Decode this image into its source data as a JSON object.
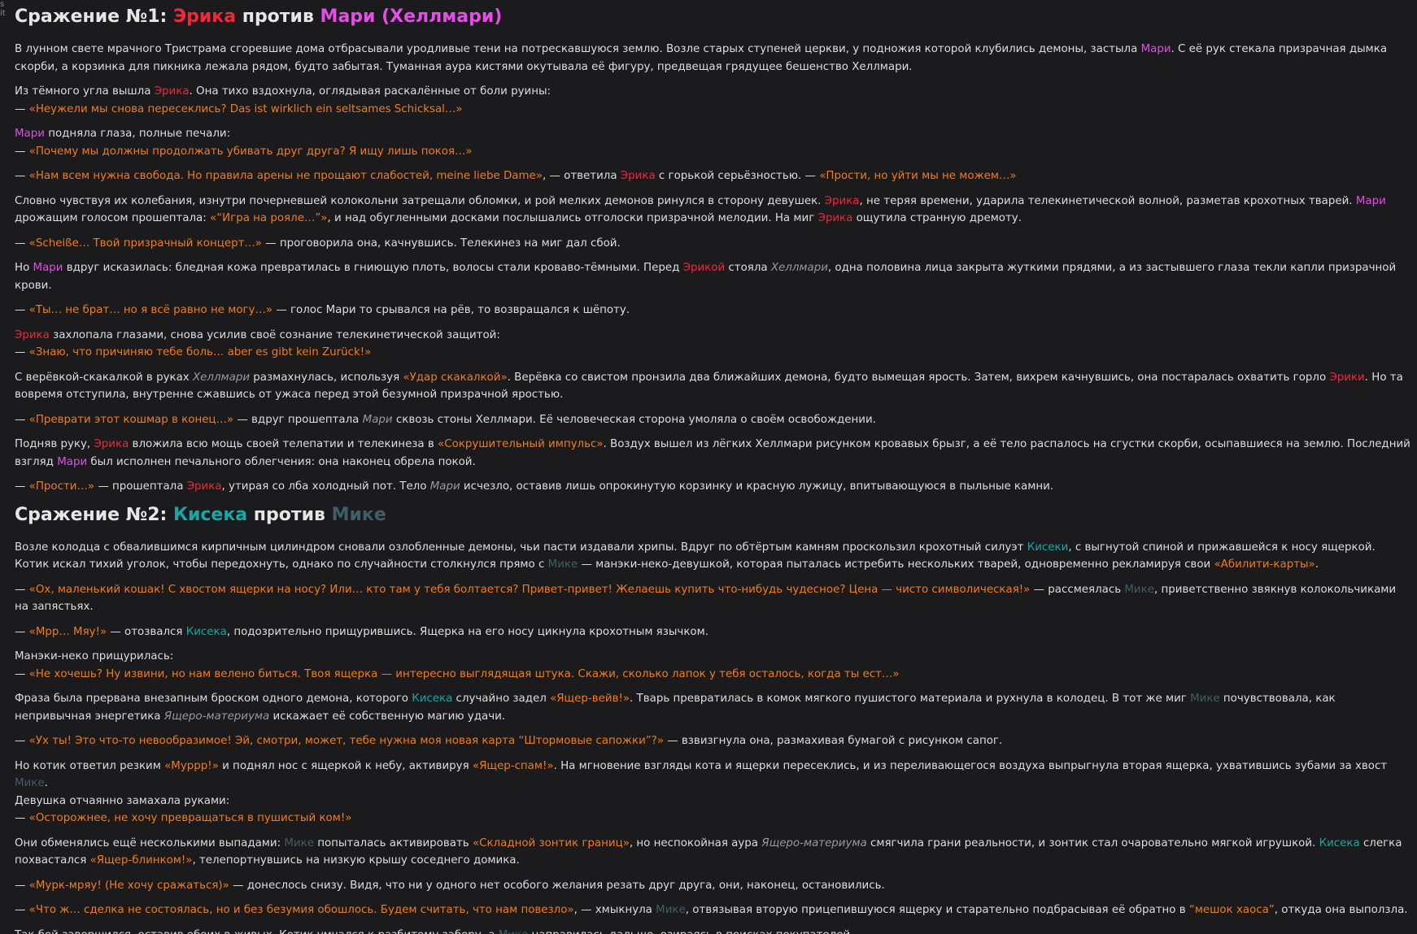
{
  "edge_marks": "s\nit",
  "colors": {
    "background": "#1b1b1d",
    "text": "#dedede",
    "erika": "#f0283c",
    "mari": "#e24ee6",
    "kiseka": "#1aa6a6",
    "mike": "#3f5f66",
    "quote": "#f17c1c",
    "italic": "#9a9a9a"
  },
  "sections": [
    {
      "heading": [
        {
          "t": "Сражение №1: ",
          "s": "plain"
        },
        {
          "t": "Эрика",
          "s": "erika"
        },
        {
          "t": " против ",
          "s": "plain"
        },
        {
          "t": "Мари (Хеллмари)",
          "s": "mari"
        }
      ],
      "paragraphs": [
        [
          {
            "t": "В лунном свете мрачного Тристрама сгоревшие дома отбрасывали уродливые тени на потрескавшуюся землю. Возле старых ступеней церкви, у подножия которой клубились демоны, застыла ",
            "s": "plain"
          },
          {
            "t": "Мари",
            "s": "mari"
          },
          {
            "t": ". С её рук стекала призрачная дымка скорби, а корзинка для пикника лежала рядом, будто забытая. Туманная аура кистями окутывала её фигуру, предвещая грядущее бешенство Хеллмари.",
            "s": "plain"
          }
        ],
        [
          {
            "t": "Из тёмного угла вышла ",
            "s": "plain"
          },
          {
            "t": "Эрика",
            "s": "erika"
          },
          {
            "t": ". Она тихо вздохнула, оглядывая раскалённые от боли руины:",
            "s": "plain"
          },
          {
            "t": "\n",
            "s": "br"
          },
          {
            "t": "— ",
            "s": "plain"
          },
          {
            "t": "«Неужели мы снова пересеклись? Das ist wirklich ein seltsames Schicksal…»",
            "s": "quote"
          }
        ],
        [
          {
            "t": "Мари",
            "s": "mari"
          },
          {
            "t": " подняла глаза, полные печали:",
            "s": "plain"
          },
          {
            "t": "\n",
            "s": "br"
          },
          {
            "t": "— ",
            "s": "plain"
          },
          {
            "t": "«Почему мы должны продолжать убивать друг друга? Я ищу лишь покоя…»",
            "s": "quote"
          }
        ],
        [
          {
            "t": "— ",
            "s": "plain"
          },
          {
            "t": "«Нам всем нужна свобода. Но правила арены не прощают слабостей, meine liebe Dame»",
            "s": "quote"
          },
          {
            "t": ", — ответила ",
            "s": "plain"
          },
          {
            "t": "Эрика",
            "s": "erika"
          },
          {
            "t": " с горькой серьёзностью. — ",
            "s": "plain"
          },
          {
            "t": "«Прости, но уйти мы не можем…»",
            "s": "quote"
          }
        ],
        [
          {
            "t": "Словно чувствуя их колебания, изнутри почерневшей колокольни затрещали обломки, и рой мелких демонов ринулся в сторону девушек. ",
            "s": "plain"
          },
          {
            "t": "Эрика",
            "s": "erika"
          },
          {
            "t": ", не теряя времени, ударила телекинетической волной, разметав крохотных тварей. ",
            "s": "plain"
          },
          {
            "t": "Мари",
            "s": "mari"
          },
          {
            "t": " дрожащим голосом прошептала: ",
            "s": "plain"
          },
          {
            "t": "«“Игра на рояле…”»",
            "s": "quote"
          },
          {
            "t": ", и над обугленными досками послышались отголоски призрачной мелодии. На миг ",
            "s": "plain"
          },
          {
            "t": "Эрика",
            "s": "erika"
          },
          {
            "t": " ощутила странную дремоту.",
            "s": "plain"
          }
        ],
        [
          {
            "t": "— ",
            "s": "plain"
          },
          {
            "t": "«Scheiße… Твой призрачный концерт…»",
            "s": "quote"
          },
          {
            "t": " — проговорила она, качнувшись. Телекинез на миг дал сбой.",
            "s": "plain"
          }
        ],
        [
          {
            "t": "Но ",
            "s": "plain"
          },
          {
            "t": "Мари",
            "s": "mari"
          },
          {
            "t": " вдруг исказилась: бледная кожа превратилась в гниющую плоть, волосы стали кроваво-тёмными. Перед ",
            "s": "plain"
          },
          {
            "t": "Эрикой",
            "s": "erika"
          },
          {
            "t": " стояла ",
            "s": "plain"
          },
          {
            "t": "Хеллмари",
            "s": "italic"
          },
          {
            "t": ", одна половина лица закрыта жуткими прядями, а из застывшего глаза текли капли призрачной крови.",
            "s": "plain"
          }
        ],
        [
          {
            "t": "— ",
            "s": "plain"
          },
          {
            "t": "«Ты… не брат… но я всё равно не могу…»",
            "s": "quote"
          },
          {
            "t": " — голос Мари то срывался на рёв, то возвращался к шёпоту.",
            "s": "plain"
          }
        ],
        [
          {
            "t": "Эрика",
            "s": "erika"
          },
          {
            "t": " захлопала глазами, снова усилив своё сознание телекинетической защитой:",
            "s": "plain"
          },
          {
            "t": "\n",
            "s": "br"
          },
          {
            "t": "— ",
            "s": "plain"
          },
          {
            "t": "«Знаю, что причиняю тебе боль… aber es gibt kein Zurück!»",
            "s": "quote"
          }
        ],
        [
          {
            "t": "С верёвкой-скакалкой в руках ",
            "s": "plain"
          },
          {
            "t": "Хеллмари",
            "s": "italic"
          },
          {
            "t": " размахнулась, используя ",
            "s": "plain"
          },
          {
            "t": "«Удар скакалкой»",
            "s": "quote"
          },
          {
            "t": ". Верёвка со свистом пронзила два ближайших демона, будто вымещая ярость. Затем, вихрем качнувшись, она постаралась охватить горло ",
            "s": "plain"
          },
          {
            "t": "Эрики",
            "s": "erika"
          },
          {
            "t": ". Но та вовремя отступила, внутренне сжавшись от ужаса перед этой безумной призрачной яростью.",
            "s": "plain"
          }
        ],
        [
          {
            "t": "— ",
            "s": "plain"
          },
          {
            "t": "«Преврати этот кошмар в конец…»",
            "s": "quote"
          },
          {
            "t": " — вдруг прошептала ",
            "s": "plain"
          },
          {
            "t": "Мари",
            "s": "italic"
          },
          {
            "t": " сквозь стоны Хеллмари. Её человеческая сторона умоляла о своём освобождении.",
            "s": "plain"
          }
        ],
        [
          {
            "t": "Подняв руку, ",
            "s": "plain"
          },
          {
            "t": "Эрика",
            "s": "erika"
          },
          {
            "t": " вложила всю мощь своей телепатии и телекинеза в ",
            "s": "plain"
          },
          {
            "t": "«Сокрушительный импульс»",
            "s": "quote"
          },
          {
            "t": ". Воздух вышел из лёгких Хеллмари рисунком кровавых брызг, а её тело распалось на сгустки скорби, осыпавшиеся на землю. Последний взгляд ",
            "s": "plain"
          },
          {
            "t": "Мари",
            "s": "mari"
          },
          {
            "t": " был исполнен печального облегчения: она наконец обрела покой.",
            "s": "plain"
          }
        ],
        [
          {
            "t": "— ",
            "s": "plain"
          },
          {
            "t": "«Прости…»",
            "s": "quote"
          },
          {
            "t": " — прошептала ",
            "s": "plain"
          },
          {
            "t": "Эрика",
            "s": "erika"
          },
          {
            "t": ", утирая со лба холодный пот. Тело ",
            "s": "plain"
          },
          {
            "t": "Мари",
            "s": "italic"
          },
          {
            "t": " исчезло, оставив лишь опрокинутую корзинку и красную лужицу, впитывающуюся в пыльные камни.",
            "s": "plain"
          }
        ]
      ]
    },
    {
      "heading": [
        {
          "t": "Сражение №2: ",
          "s": "plain"
        },
        {
          "t": "Кисека",
          "s": "kiseka"
        },
        {
          "t": " против ",
          "s": "plain"
        },
        {
          "t": "Мике",
          "s": "mike"
        }
      ],
      "paragraphs": [
        [
          {
            "t": "Возле колодца с обвалившимся кирпичным цилиндром сновали озлобленные демоны, чьи пасти издавали хрипы. Вдруг по обтёртым камням проскользил крохотный силуэт ",
            "s": "plain"
          },
          {
            "t": "Кисеки",
            "s": "kiseka"
          },
          {
            "t": ", с выгнутой спиной и прижавшейся к носу ящеркой. Котик искал тихий уголок, чтобы передохнуть, однако по случайности столкнулся прямо с ",
            "s": "plain"
          },
          {
            "t": "Мике",
            "s": "mike"
          },
          {
            "t": " — манэки-неко-девушкой, которая пыталась истребить нескольких тварей, одновременно рекламируя свои ",
            "s": "plain"
          },
          {
            "t": "«Абилити-карты»",
            "s": "quote"
          },
          {
            "t": ".",
            "s": "plain"
          }
        ],
        [
          {
            "t": "— ",
            "s": "plain"
          },
          {
            "t": "«Ох, маленький кошак! С хвостом ящерки на носу? Или… кто там у тебя болтается? Привет-привет! Желаешь купить что-нибудь чудесное? Цена — чисто символическая!»",
            "s": "quote"
          },
          {
            "t": " — рассмеялась ",
            "s": "plain"
          },
          {
            "t": "Мике",
            "s": "mike"
          },
          {
            "t": ", приветственно звякнув колокольчиками на запястьях.",
            "s": "plain"
          }
        ],
        [
          {
            "t": "— ",
            "s": "plain"
          },
          {
            "t": "«Мрр… Мяу!»",
            "s": "quote"
          },
          {
            "t": " — отозвался ",
            "s": "plain"
          },
          {
            "t": "Кисека",
            "s": "kiseka"
          },
          {
            "t": ", подозрительно прищурившись. Ящерка на его носу цикнула крохотным язычком.",
            "s": "plain"
          }
        ],
        [
          {
            "t": "Манэки-неко прищурилась:",
            "s": "plain"
          },
          {
            "t": "\n",
            "s": "br"
          },
          {
            "t": "— ",
            "s": "plain"
          },
          {
            "t": "«Не хочешь? Ну извини, но нам велено биться. Твоя ящерка — интересно выглядящая штука. Скажи, сколько лапок у тебя осталось, когда ты ест…»",
            "s": "quote"
          }
        ],
        [
          {
            "t": "Фраза была прервана внезапным броском одного демона, которого ",
            "s": "plain"
          },
          {
            "t": "Кисека",
            "s": "kiseka"
          },
          {
            "t": " случайно задел ",
            "s": "plain"
          },
          {
            "t": "«Ящер-вейв!»",
            "s": "quote"
          },
          {
            "t": ". Тварь превратилась в комок мягкого пушистого материала и рухнула в колодец. В тот же миг ",
            "s": "plain"
          },
          {
            "t": "Мике",
            "s": "mike"
          },
          {
            "t": " почувствовала, как непривычная энергетика ",
            "s": "plain"
          },
          {
            "t": "Ящеро-материума",
            "s": "italic"
          },
          {
            "t": " искажает её собственную магию удачи.",
            "s": "plain"
          }
        ],
        [
          {
            "t": "— ",
            "s": "plain"
          },
          {
            "t": "«Ух ты! Это что-то невообразимое! Эй, смотри, может, тебе нужна моя новая карта “Штормовые сапожки”?»",
            "s": "quote"
          },
          {
            "t": " — взвизгнула она, размахивая бумагой с рисунком сапог.",
            "s": "plain"
          }
        ],
        [
          {
            "t": "Но котик ответил резким ",
            "s": "plain"
          },
          {
            "t": "«Муррр!»",
            "s": "quote"
          },
          {
            "t": " и поднял нос с ящеркой к небу, активируя ",
            "s": "plain"
          },
          {
            "t": "«Ящер-спам!»",
            "s": "quote"
          },
          {
            "t": ". На мгновение взгляды кота и ящерки пересеклись, и из переливающегося воздуха выпрыгнула вторая ящерка, ухватившись зубами за хвост ",
            "s": "plain"
          },
          {
            "t": "Мике",
            "s": "mike"
          },
          {
            "t": ".",
            "s": "plain"
          },
          {
            "t": "\n",
            "s": "br"
          },
          {
            "t": "Девушка отчаянно замахала руками:",
            "s": "plain"
          },
          {
            "t": "\n",
            "s": "br"
          },
          {
            "t": "— ",
            "s": "plain"
          },
          {
            "t": "«Осторожнее, не хочу превращаться в пушистый ком!»",
            "s": "quote"
          }
        ],
        [
          {
            "t": "Они обменялись ещё несколькими выпадами: ",
            "s": "plain"
          },
          {
            "t": "Мике",
            "s": "mike"
          },
          {
            "t": " попыталась активировать ",
            "s": "plain"
          },
          {
            "t": "«Складной зонтик границ»",
            "s": "quote"
          },
          {
            "t": ", но неспокойная аура ",
            "s": "plain"
          },
          {
            "t": "Ящеро-материума",
            "s": "italic"
          },
          {
            "t": " смягчила грани реальности, и зонтик стал очаровательно мягкой игрушкой. ",
            "s": "plain"
          },
          {
            "t": "Кисека",
            "s": "kiseka"
          },
          {
            "t": " слегка похвастался ",
            "s": "plain"
          },
          {
            "t": "«Ящер-блинком!»",
            "s": "quote"
          },
          {
            "t": ", телепортнувшись на низкую крышу соседнего домика.",
            "s": "plain"
          }
        ],
        [
          {
            "t": "— ",
            "s": "plain"
          },
          {
            "t": "«Мурк-мряу! (Не хочу сражаться)»",
            "s": "quote"
          },
          {
            "t": " — донеслось снизу. Видя, что ни у одного нет особого желания резать друг друга, они, наконец, остановились.",
            "s": "plain"
          }
        ],
        [
          {
            "t": "— ",
            "s": "plain"
          },
          {
            "t": "«Что ж… сделка не состоялась, но и без безумия обошлось. Будем считать, что нам повезло»",
            "s": "quote"
          },
          {
            "t": ", — хмыкнула ",
            "s": "plain"
          },
          {
            "t": "Мике",
            "s": "mike"
          },
          {
            "t": ", отвязывая вторую прицепившуюся ящерку и старательно подбрасывая её обратно в ",
            "s": "plain"
          },
          {
            "t": "“мешок хаоса”",
            "s": "quote"
          },
          {
            "t": ", откуда она выползла.",
            "s": "plain"
          }
        ],
        [
          {
            "t": "Так бой завершился, оставив обоих в живых. Котик умчался к разбитому забору, а ",
            "s": "plain"
          },
          {
            "t": "Мике",
            "s": "mike"
          },
          {
            "t": " направилась дальше, озираясь в поисках покупателей.",
            "s": "plain"
          }
        ]
      ]
    }
  ]
}
